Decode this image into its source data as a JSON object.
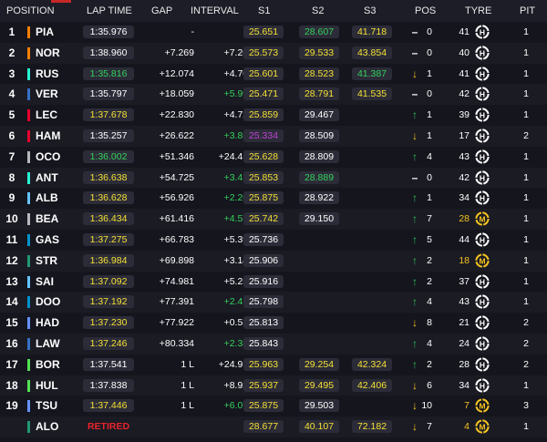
{
  "header": {
    "position": "POSITION",
    "lap_time": "LAP TIME",
    "gap": "GAP",
    "interval": "INTERVAL",
    "s1": "S1",
    "s2": "S2",
    "s3": "S3",
    "pos": "POS",
    "tyre": "TYRE",
    "pit": "PIT"
  },
  "colors": {
    "background": "#15151e",
    "row_alt": "#1b1b24",
    "header_bg": "#1d1d27",
    "pill_bg": "#2c2c38",
    "normal": "#ffffff",
    "personal_best": "#33d35a",
    "overall_best": "#c042d8",
    "sector_yellow": "#f3e034",
    "gain_green": "#2ec15a",
    "loss_yellow": "#f5c41f",
    "retired_red": "#e8242b",
    "tyre_hard": "#ffffff",
    "tyre_medium": "#f5c41f"
  },
  "rows": [
    {
      "pos": "1",
      "driver": "PIA",
      "team_color": "#ff8000",
      "lap_time": "1:35.976",
      "lap_color": "white",
      "gap": "-",
      "interval": "-",
      "interval_color": "white",
      "s1": "25.651",
      "s1_color": "yellow",
      "s2": "28.607",
      "s2_color": "green",
      "s3": "41.718",
      "s3_color": "yellow",
      "arrow": "dash",
      "change": "0",
      "tyre_laps": "41",
      "tyre_compound": "H",
      "pit": "1"
    },
    {
      "pos": "2",
      "driver": "NOR",
      "team_color": "#ff8000",
      "lap_time": "1:38.960",
      "lap_color": "white",
      "gap": "+7.269",
      "interval": "+7.269",
      "interval_color": "white",
      "s1": "25.573",
      "s1_color": "yellow",
      "s2": "29.533",
      "s2_color": "yellow",
      "s3": "43.854",
      "s3_color": "yellow",
      "arrow": "dash",
      "change": "0",
      "tyre_laps": "40",
      "tyre_compound": "H",
      "pit": "1"
    },
    {
      "pos": "3",
      "driver": "RUS",
      "team_color": "#27f4d2",
      "lap_time": "1:35.816",
      "lap_color": "green",
      "gap": "+12.074",
      "interval": "+4.708",
      "interval_color": "white",
      "s1": "25.601",
      "s1_color": "yellow",
      "s2": "28.523",
      "s2_color": "yellow",
      "s3": "41.387",
      "s3_color": "green",
      "arrow": "down",
      "change": "1",
      "tyre_laps": "41",
      "tyre_compound": "H",
      "pit": "1"
    },
    {
      "pos": "4",
      "driver": "VER",
      "team_color": "#3671c6",
      "lap_time": "1:35.797",
      "lap_color": "white",
      "gap": "+18.059",
      "interval": "+5.991",
      "interval_color": "green",
      "s1": "25.471",
      "s1_color": "yellow",
      "s2": "28.791",
      "s2_color": "yellow",
      "s3": "41.535",
      "s3_color": "yellow",
      "arrow": "dash",
      "change": "0",
      "tyre_laps": "42",
      "tyre_compound": "H",
      "pit": "1"
    },
    {
      "pos": "5",
      "driver": "LEC",
      "team_color": "#e8002d",
      "lap_time": "1:37.678",
      "lap_color": "yellow",
      "gap": "+22.830",
      "interval": "+4.728",
      "interval_color": "white",
      "s1": "25.859",
      "s1_color": "yellow",
      "s2": "29.467",
      "s2_color": "white",
      "s3": "",
      "s3_color": "white",
      "arrow": "up",
      "change": "1",
      "tyre_laps": "39",
      "tyre_compound": "H",
      "pit": "1"
    },
    {
      "pos": "6",
      "driver": "HAM",
      "team_color": "#e8002d",
      "lap_time": "1:35.257",
      "lap_color": "white",
      "gap": "+26.622",
      "interval": "+3.861",
      "interval_color": "green",
      "s1": "25.334",
      "s1_color": "purple",
      "s2": "28.509",
      "s2_color": "white",
      "s3": "",
      "s3_color": "white",
      "arrow": "down",
      "change": "1",
      "tyre_laps": "17",
      "tyre_compound": "H",
      "pit": "2"
    },
    {
      "pos": "7",
      "driver": "OCO",
      "team_color": "#b6babd",
      "lap_time": "1:36.002",
      "lap_color": "green",
      "gap": "+51.346",
      "interval": "+24.460",
      "interval_color": "white",
      "s1": "25.628",
      "s1_color": "yellow",
      "s2": "28.809",
      "s2_color": "white",
      "s3": "",
      "s3_color": "white",
      "arrow": "up",
      "change": "4",
      "tyre_laps": "43",
      "tyre_compound": "H",
      "pit": "1"
    },
    {
      "pos": "8",
      "driver": "ANT",
      "team_color": "#27f4d2",
      "lap_time": "1:36.638",
      "lap_color": "yellow",
      "gap": "+54.725",
      "interval": "+3.412",
      "interval_color": "green",
      "s1": "25.853",
      "s1_color": "yellow",
      "s2": "28.889",
      "s2_color": "green",
      "s3": "",
      "s3_color": "white",
      "arrow": "dash",
      "change": "0",
      "tyre_laps": "42",
      "tyre_compound": "H",
      "pit": "1"
    },
    {
      "pos": "9",
      "driver": "ALB",
      "team_color": "#64c4ff",
      "lap_time": "1:36.628",
      "lap_color": "yellow",
      "gap": "+56.926",
      "interval": "+2.201",
      "interval_color": "green",
      "s1": "25.875",
      "s1_color": "yellow",
      "s2": "28.922",
      "s2_color": "white",
      "s3": "",
      "s3_color": "white",
      "arrow": "up",
      "change": "1",
      "tyre_laps": "34",
      "tyre_compound": "H",
      "pit": "1"
    },
    {
      "pos": "10",
      "driver": "BEA",
      "team_color": "#b6babd",
      "lap_time": "1:36.434",
      "lap_color": "yellow",
      "gap": "+61.416",
      "interval": "+4.579",
      "interval_color": "green",
      "s1": "25.742",
      "s1_color": "yellow",
      "s2": "29.150",
      "s2_color": "white",
      "s3": "",
      "s3_color": "white",
      "arrow": "up",
      "change": "7",
      "tyre_laps": "28",
      "tyre_compound": "M",
      "pit": "1"
    },
    {
      "pos": "11",
      "driver": "GAS",
      "team_color": "#0093cc",
      "lap_time": "1:37.275",
      "lap_color": "yellow",
      "gap": "+66.783",
      "interval": "+5.395",
      "interval_color": "white",
      "s1": "25.736",
      "s1_color": "white",
      "s2": "",
      "s2_color": "white",
      "s3": "",
      "s3_color": "white",
      "arrow": "up",
      "change": "5",
      "tyre_laps": "44",
      "tyre_compound": "H",
      "pit": "1"
    },
    {
      "pos": "12",
      "driver": "STR",
      "team_color": "#229971",
      "lap_time": "1:36.984",
      "lap_color": "yellow",
      "gap": "+69.898",
      "interval": "+3.148",
      "interval_color": "white",
      "s1": "25.906",
      "s1_color": "white",
      "s2": "",
      "s2_color": "white",
      "s3": "",
      "s3_color": "white",
      "arrow": "up",
      "change": "2",
      "tyre_laps": "18",
      "tyre_compound": "M",
      "pit": "1"
    },
    {
      "pos": "13",
      "driver": "SAI",
      "team_color": "#64c4ff",
      "lap_time": "1:37.092",
      "lap_color": "yellow",
      "gap": "+74.981",
      "interval": "+5.251",
      "interval_color": "white",
      "s1": "25.916",
      "s1_color": "white",
      "s2": "",
      "s2_color": "white",
      "s3": "",
      "s3_color": "white",
      "arrow": "up",
      "change": "2",
      "tyre_laps": "37",
      "tyre_compound": "H",
      "pit": "1"
    },
    {
      "pos": "14",
      "driver": "DOO",
      "team_color": "#0093cc",
      "lap_time": "1:37.192",
      "lap_color": "yellow",
      "gap": "+77.391",
      "interval": "+2.410",
      "interval_color": "green",
      "s1": "25.798",
      "s1_color": "white",
      "s2": "",
      "s2_color": "white",
      "s3": "",
      "s3_color": "white",
      "arrow": "up",
      "change": "4",
      "tyre_laps": "43",
      "tyre_compound": "H",
      "pit": "1"
    },
    {
      "pos": "15",
      "driver": "HAD",
      "team_color": "#6692ff",
      "lap_time": "1:37.230",
      "lap_color": "yellow",
      "gap": "+77.922",
      "interval": "+0.531",
      "interval_color": "white",
      "s1": "25.813",
      "s1_color": "white",
      "s2": "",
      "s2_color": "white",
      "s3": "",
      "s3_color": "white",
      "arrow": "down",
      "change": "8",
      "tyre_laps": "21",
      "tyre_compound": "H",
      "pit": "2"
    },
    {
      "pos": "16",
      "driver": "LAW",
      "team_color": "#3671c6",
      "lap_time": "1:37.246",
      "lap_color": "yellow",
      "gap": "+80.334",
      "interval": "+2.387",
      "interval_color": "green",
      "s1": "25.843",
      "s1_color": "white",
      "s2": "",
      "s2_color": "white",
      "s3": "",
      "s3_color": "white",
      "arrow": "up",
      "change": "4",
      "tyre_laps": "24",
      "tyre_compound": "H",
      "pit": "2"
    },
    {
      "pos": "17",
      "driver": "BOR",
      "team_color": "#52e252",
      "lap_time": "1:37.541",
      "lap_color": "white",
      "gap": "1 L",
      "interval": "+24.957",
      "interval_color": "white",
      "s1": "25.963",
      "s1_color": "yellow",
      "s2": "29.254",
      "s2_color": "yellow",
      "s3": "42.324",
      "s3_color": "yellow",
      "arrow": "up",
      "change": "2",
      "tyre_laps": "28",
      "tyre_compound": "H",
      "pit": "2"
    },
    {
      "pos": "18",
      "driver": "HUL",
      "team_color": "#52e252",
      "lap_time": "1:37.838",
      "lap_color": "white",
      "gap": "1 L",
      "interval": "+8.925",
      "interval_color": "white",
      "s1": "25.937",
      "s1_color": "yellow",
      "s2": "29.495",
      "s2_color": "yellow",
      "s3": "42.406",
      "s3_color": "yellow",
      "arrow": "down",
      "change": "6",
      "tyre_laps": "34",
      "tyre_compound": "H",
      "pit": "1"
    },
    {
      "pos": "19",
      "driver": "TSU",
      "team_color": "#6692ff",
      "lap_time": "1:37.446",
      "lap_color": "yellow",
      "gap": "1 L",
      "interval": "+6.074",
      "interval_color": "green",
      "s1": "25.875",
      "s1_color": "yellow",
      "s2": "29.503",
      "s2_color": "white",
      "s3": "",
      "s3_color": "white",
      "arrow": "down",
      "change": "10",
      "tyre_laps": "7",
      "tyre_compound": "M",
      "pit": "3"
    },
    {
      "pos": "",
      "driver": "ALO",
      "team_color": "#229971",
      "lap_time": "RETIRED",
      "lap_color": "red",
      "gap": "",
      "interval": "",
      "interval_color": "white",
      "s1": "28.677",
      "s1_color": "yellow",
      "s2": "40.107",
      "s2_color": "yellow",
      "s3": "72.182",
      "s3_color": "yellow",
      "arrow": "down",
      "change": "7",
      "tyre_laps": "4",
      "tyre_compound": "M",
      "pit": "1"
    }
  ]
}
